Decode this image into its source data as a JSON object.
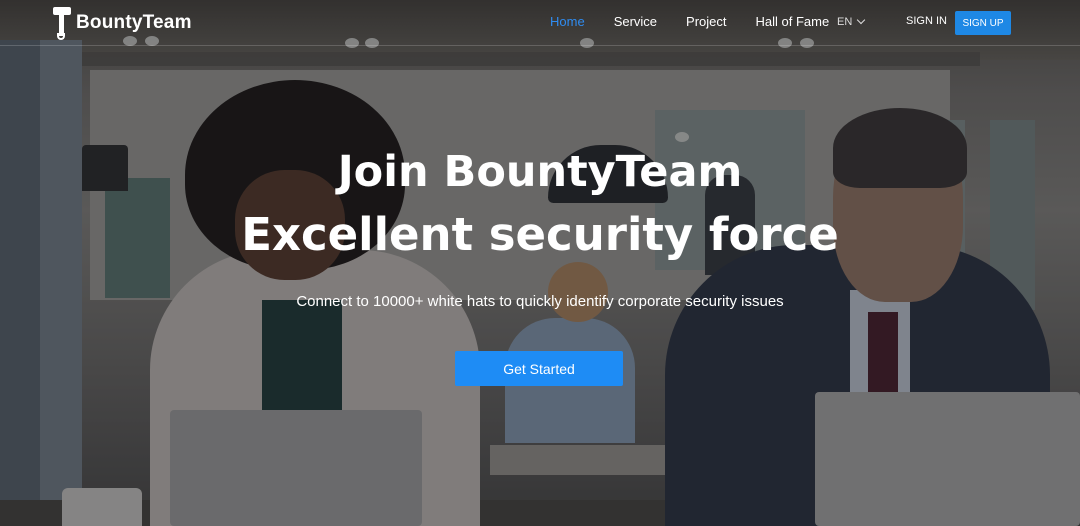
{
  "brand": {
    "name": "BountyTeam"
  },
  "nav": {
    "items": [
      {
        "label": "Home",
        "active": true
      },
      {
        "label": "Service",
        "active": false
      },
      {
        "label": "Project",
        "active": false
      },
      {
        "label": "Hall of Fame",
        "active": false
      }
    ],
    "language": "EN",
    "sign_in": "SIGN IN",
    "sign_up": "SIGN UP"
  },
  "hero": {
    "title_line1": "Join BountyTeam",
    "title_line2": "Excellent security force",
    "subtitle": "Connect to 10000+ white hats to quickly identify corporate security issues",
    "cta_label": "Get Started"
  },
  "colors": {
    "accent": "#1e8cf5",
    "active_nav": "#2f8cf0",
    "text": "#ffffff"
  }
}
